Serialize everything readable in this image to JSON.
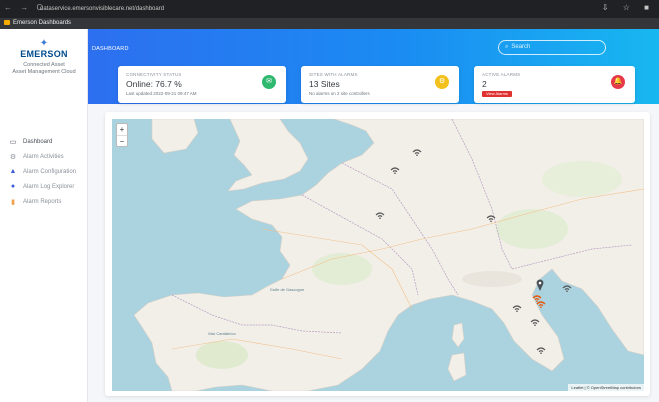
{
  "browser": {
    "nav_glyphs": "← → C",
    "url": "dataservice.emersonvisiblecare.net/dashboard",
    "bookmark": "Emerson Dashboards",
    "ext_glyphs": "⇩ ☆ ■"
  },
  "sidebar": {
    "logo_mark": "✦",
    "brand": "EMERSON",
    "subtitle_line1": "Connected Asset",
    "subtitle_line2": "Asset Management Cloud",
    "items": [
      {
        "label": "Dashboard",
        "icon": "desktop-icon",
        "glyph": "▭"
      },
      {
        "label": "Alarm Activities",
        "icon": "gear-icon",
        "glyph": "⚙"
      },
      {
        "label": "Alarm Configuration",
        "icon": "bell-icon",
        "glyph": "▲"
      },
      {
        "label": "Alarm Log Explorer",
        "icon": "info-icon",
        "glyph": "●"
      },
      {
        "label": "Alarm Reports",
        "icon": "report-icon",
        "glyph": "▮"
      }
    ]
  },
  "header": {
    "title": "DASHBOARD",
    "search_placeholder": "Search",
    "search_glyph": "⌕"
  },
  "cards": {
    "status": {
      "label": "CONNECTIVITY STATUS",
      "value": "Online: 76.7 %",
      "note": "Last updated 2022-09-21 09:47 AM",
      "badge_glyph": "✉",
      "color": "#2fb86f"
    },
    "sites": {
      "label": "SITES WITH ALARMS",
      "value": "13 Sites",
      "note": "No alarms on 2 site controllers",
      "badge_glyph": "⚙",
      "color": "#f2c11b"
    },
    "alarms": {
      "label": "ACTIVE ALARMS",
      "value": "2",
      "button": "View Alarms",
      "badge_glyph": "🔔",
      "color": "#e5394a"
    }
  },
  "map": {
    "zoom_in": "+",
    "zoom_out": "−",
    "attribution": "Leaflet | © OpenStreetMap contributors",
    "bay_label_1": "Golfe de Gascogne",
    "bay_label_2": "Mar Cantábrico",
    "land_color": "#f2efe9",
    "water_color": "#aad3df",
    "marker_color": "#6c757d",
    "alert_color": "#e8590c"
  }
}
